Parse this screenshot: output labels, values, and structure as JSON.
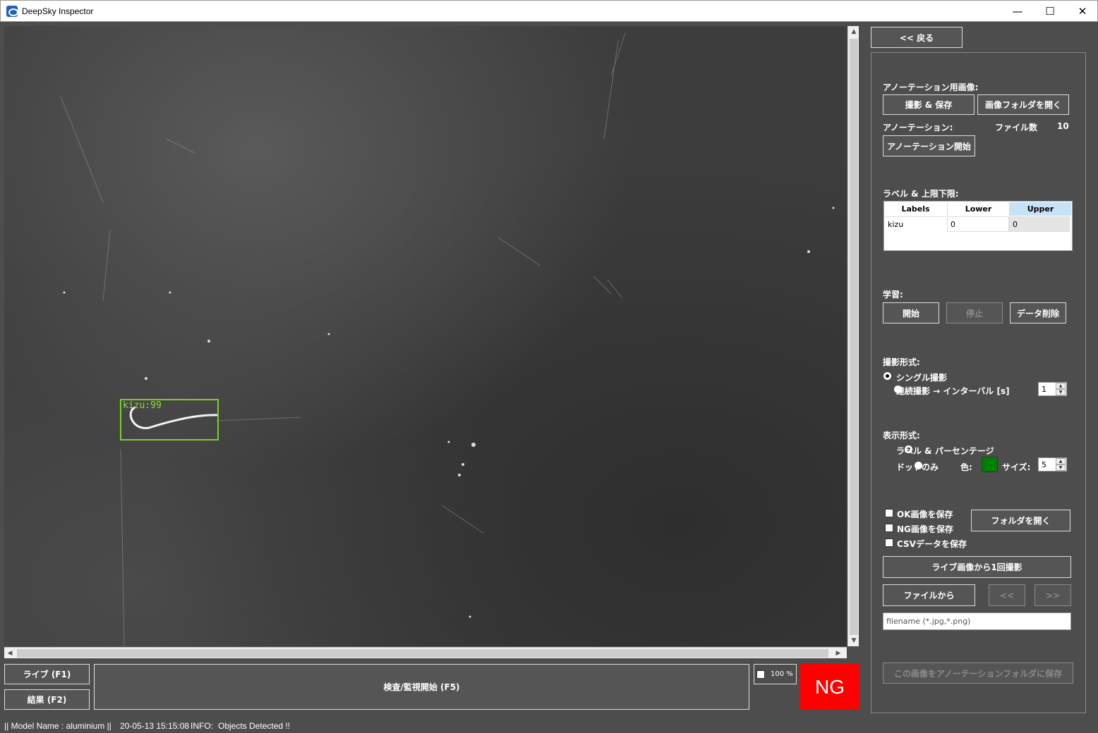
{
  "window": {
    "title": "DeepSky Inspector",
    "minimize": "—",
    "maximize": "☐",
    "close": "✕"
  },
  "viewer": {
    "detection_label": "kizu:99",
    "scroll_up": "▲",
    "scroll_down": "▼",
    "scroll_left": "◀",
    "scroll_right": "▶"
  },
  "controls": {
    "live_btn": "ライブ (F1)",
    "result_btn": "結果 (F2)",
    "inspect_btn": "検査/監視開始 (F5)",
    "zoom_label": "100 %",
    "verdict": "NG"
  },
  "status": {
    "model": "|| Model Name : aluminium ||",
    "timestamp": "20-05-13 15:15:08",
    "info_label": "INFO:",
    "info_msg": "Objects Detected !!"
  },
  "panel": {
    "back_btn": "<< 戻る",
    "annot_img_title": "アノーテーション用画像:",
    "capture_save_btn": "撮影 & 保存",
    "open_img_folder_btn": "画像フォルダを開く",
    "annotation_label": "アノーテーション:",
    "file_count_label": "ファイル数",
    "file_count": "10",
    "start_annotation_btn": "アノーテーション開始",
    "label_limits_title": "ラベル & 上限下限:",
    "table": {
      "headers": [
        "Labels",
        "Lower",
        "Upper"
      ],
      "rows": [
        [
          "kizu",
          "0",
          "0"
        ]
      ]
    },
    "learning_title": "学習:",
    "learn_start_btn": "開始",
    "learn_stop_btn": "停止",
    "data_delete_btn": "データ削除",
    "capture_mode_title": "撮影形式:",
    "single_capture": "シングル撮影",
    "continuous_capture": "連続撮影 → インターバル [s]",
    "interval_value": "1",
    "display_mode_title": "表示形式:",
    "label_percentage": "ラベル & パーセンテージ",
    "dot_only": "ドットのみ",
    "color_label": "色:",
    "dot_color": "#008000",
    "size_label": "サイズ:",
    "size_value": "5",
    "save_ok": "OK画像を保存",
    "save_ng": "NG画像を保存",
    "save_csv": "CSVデータを保存",
    "open_folder_btn": "フォルダを開く",
    "live_capture_btn": "ライブ画像から1回撮影",
    "from_file_btn": "ファイルから",
    "prev_btn": "<<",
    "next_btn": ">>",
    "filename_placeholder": "filename (*.jpg,*.png)",
    "save_to_annot_btn": "この画像をアノーテーションフォルダに保存"
  }
}
